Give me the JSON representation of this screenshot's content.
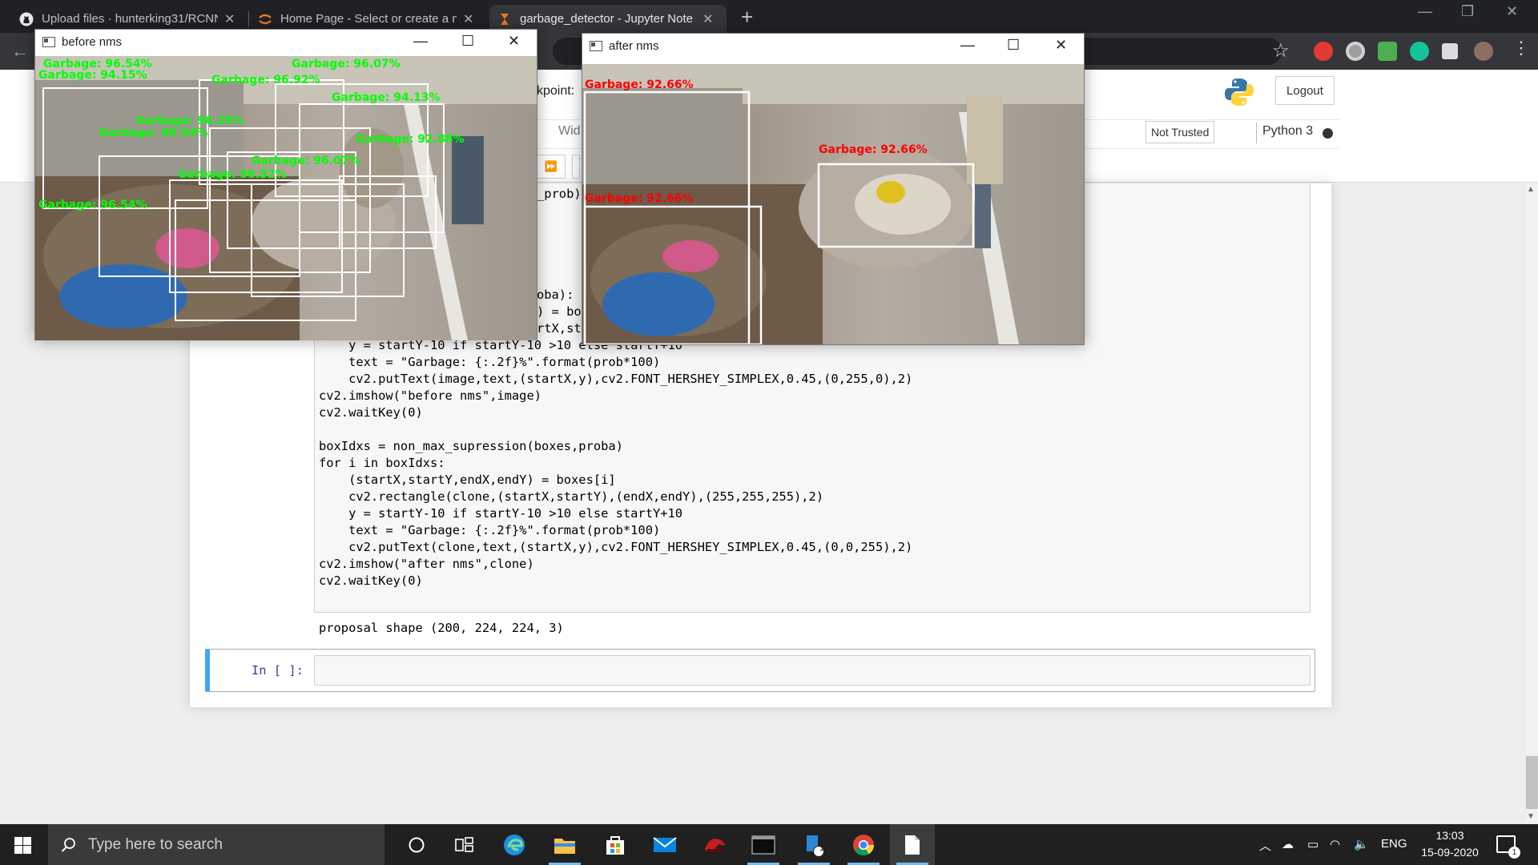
{
  "browser": {
    "tabs": [
      {
        "title": "Upload files · hunterking31/RCNN",
        "close": "✕",
        "icon": "github-icon"
      },
      {
        "title": "Home Page - Select or create a n",
        "close": "✕",
        "icon": "jupyter-icon"
      },
      {
        "title": "garbage_detector - Jupyter Note",
        "close": "✕",
        "icon": "hourglass-icon"
      }
    ],
    "new_tab": "+",
    "window_controls": {
      "minimize": "—",
      "restore": "❐",
      "close": "✕"
    }
  },
  "jupyter": {
    "checkpoint_fragment": "kpoint:",
    "logout_label": "Logout",
    "menu_fragment": "Wid",
    "not_trusted_label": "Not Trusted",
    "kernel_name": "Python 3",
    "run_button_glyph": "⏩"
  },
  "code": {
    "frag_prob": "_prob)",
    "frag_proba": "oba):",
    "frag_bo": ") = bo",
    "frag_rtx": "rtX,st",
    "line_y1_code": "    y = startY-10 if startY-10 >10 else startY+10",
    "lines": [
      "    text = \"Garbage: {:.2f}%\".format(prob*100)",
      "    cv2.putText(image,text,(startX,y),cv2.FONT_HERSHEY_SIMPLEX,0.45,(0,255,0),2)",
      "cv2.imshow(\"before nms\",image)",
      "cv2.waitKey(0)",
      "",
      "boxIdxs = non_max_supression(boxes,proba)",
      "for i in boxIdxs:",
      "    (startX,startY,endX,endY) = boxes[i]",
      "    cv2.rectangle(clone,(startX,startY),(endX,endY),(255,255,255),2)",
      "    y = startY-10 if startY-10 >10 else startY+10",
      "    text = \"Garbage: {:.2f}%\".format(prob*100)",
      "    cv2.putText(clone,text,(startX,y),cv2.FONT_HERSHEY_SIMPLEX,0.45,(0,0,255),2)",
      "cv2.imshow(\"after nms\",clone)",
      "cv2.waitKey(0)"
    ],
    "output": "proposal shape (200, 224, 224, 3)",
    "prompt": "In [ ]:"
  },
  "windows": {
    "before": {
      "title": "before nms",
      "labels": [
        "Garbage: 96.54%",
        "Garbage: 94.15%",
        "Garbage: 96.92%",
        "Garbage: 96.07%",
        "Garbage: 94.13%",
        "Garbage: 96.26%",
        "Garbage: 96.54%",
        "Garbage: 92.88%",
        "Garbage: 96.07%",
        "Garbage: 96.92%",
        "Garbage: 96.54%"
      ]
    },
    "after": {
      "title": "after nms",
      "labels": [
        "Garbage: 92.66%",
        "Garbage: 92.66%",
        "Garbage: 92.66%"
      ]
    }
  },
  "taskbar": {
    "search_placeholder": "Type here to search",
    "language": "ENG",
    "time": "13:03",
    "date": "15-09-2020",
    "notification_count": "1",
    "app_badge": "1"
  }
}
